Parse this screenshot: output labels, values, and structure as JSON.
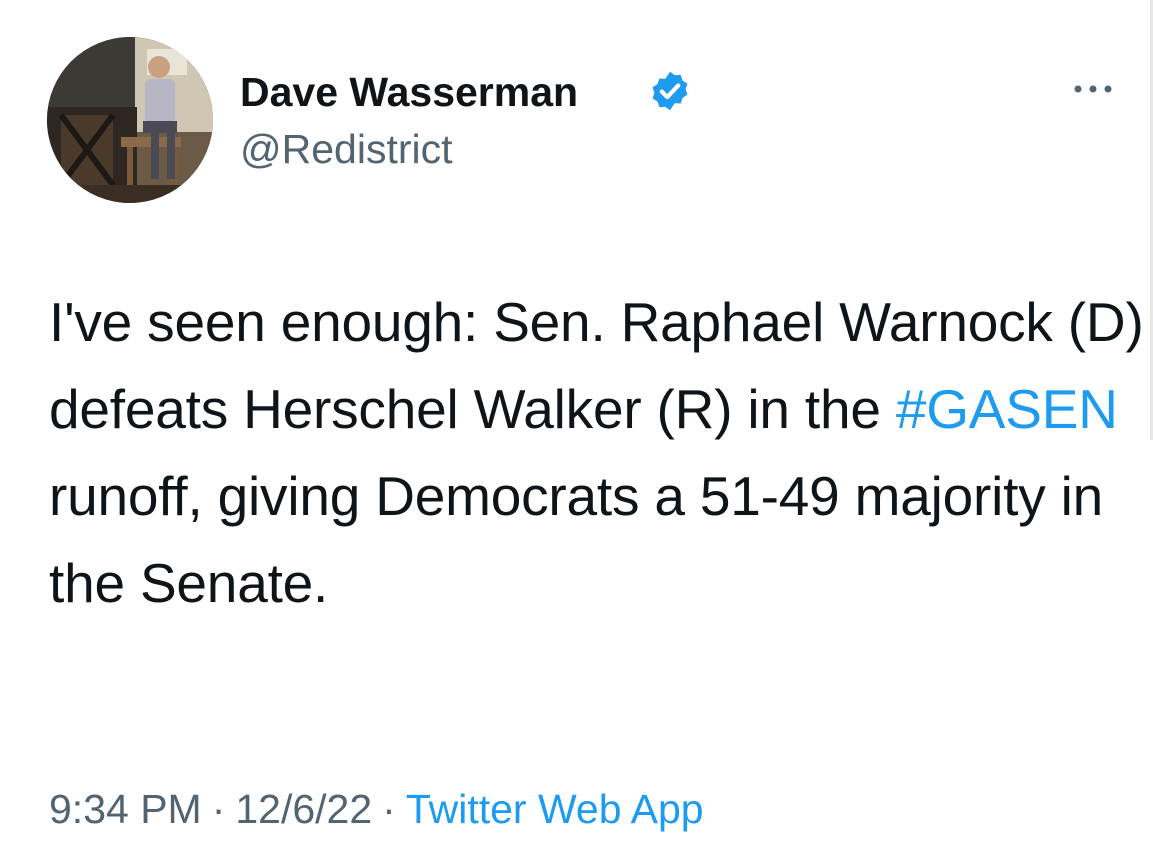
{
  "author": {
    "display_name": "Dave Wasserman",
    "handle": "@Redistrict",
    "verified": true,
    "avatar_icon": "profile-photo"
  },
  "tweet": {
    "text_before": "I've seen enough: Sen. Raphael Warnock (D) defeats Herschel Walker (R) in the ",
    "hashtag": "#GASEN",
    "text_after": " runoff, giving Democrats a 51-49 majority in the Senate."
  },
  "meta": {
    "time": "9:34 PM",
    "separator": "·",
    "date": "12/6/22",
    "source": "Twitter Web App"
  },
  "icons": {
    "verified": "verified-badge-icon",
    "more": "more-options-icon"
  },
  "colors": {
    "link": "#1d9bf0",
    "secondary_text": "#536471",
    "primary_text": "#0f1419"
  }
}
